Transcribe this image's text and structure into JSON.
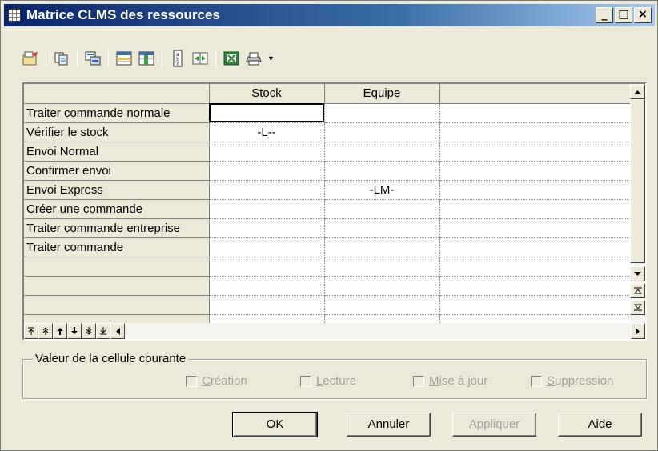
{
  "window": {
    "title": "Matrice CLMS des ressources",
    "controls": {
      "minimize": "_",
      "maximize": "□",
      "close": "×"
    }
  },
  "toolbar": {
    "icons": [
      "properties-icon",
      "copy-icon",
      "find-icon",
      "select-rows-icon",
      "select-columns-icon",
      "vertical-text-icon",
      "adjust-columns-icon",
      "excel-export-icon",
      "print-icon",
      "dropdown-arrow-icon"
    ]
  },
  "grid": {
    "columns": [
      "Stock",
      "Equipe",
      ""
    ],
    "rows": [
      {
        "label": "Traiter commande normale",
        "cells": [
          "",
          "",
          ""
        ]
      },
      {
        "label": "Vérifier le stock",
        "cells": [
          "-L--",
          "",
          ""
        ]
      },
      {
        "label": "Envoi Normal",
        "cells": [
          "",
          "",
          ""
        ]
      },
      {
        "label": "Confirmer envoi",
        "cells": [
          "",
          "",
          ""
        ]
      },
      {
        "label": "Envoi Express",
        "cells": [
          "",
          "-LM-",
          ""
        ]
      },
      {
        "label": "Créer une commande",
        "cells": [
          "",
          "",
          ""
        ]
      },
      {
        "label": "Traiter commande entreprise",
        "cells": [
          "",
          "",
          ""
        ]
      },
      {
        "label": "Traiter commande",
        "cells": [
          "",
          "",
          ""
        ]
      },
      {
        "label": "",
        "cells": [
          "",
          "",
          ""
        ]
      },
      {
        "label": "",
        "cells": [
          "",
          "",
          ""
        ]
      },
      {
        "label": "",
        "cells": [
          "",
          "",
          ""
        ]
      },
      {
        "label": "",
        "cells": [
          "",
          "",
          ""
        ]
      }
    ]
  },
  "current_cell": {
    "legend": "Valeur de la cellule courante",
    "options": [
      {
        "label_pre": "",
        "accel": "C",
        "label_post": "réation"
      },
      {
        "label_pre": "",
        "accel": "L",
        "label_post": "ecture"
      },
      {
        "label_pre": "",
        "accel": "M",
        "label_post": "ise à jour"
      },
      {
        "label_pre": "",
        "accel": "S",
        "label_post": "uppression"
      }
    ]
  },
  "buttons": {
    "ok": "OK",
    "cancel": "Annuler",
    "apply": "Appliquer",
    "help": "Aide"
  }
}
